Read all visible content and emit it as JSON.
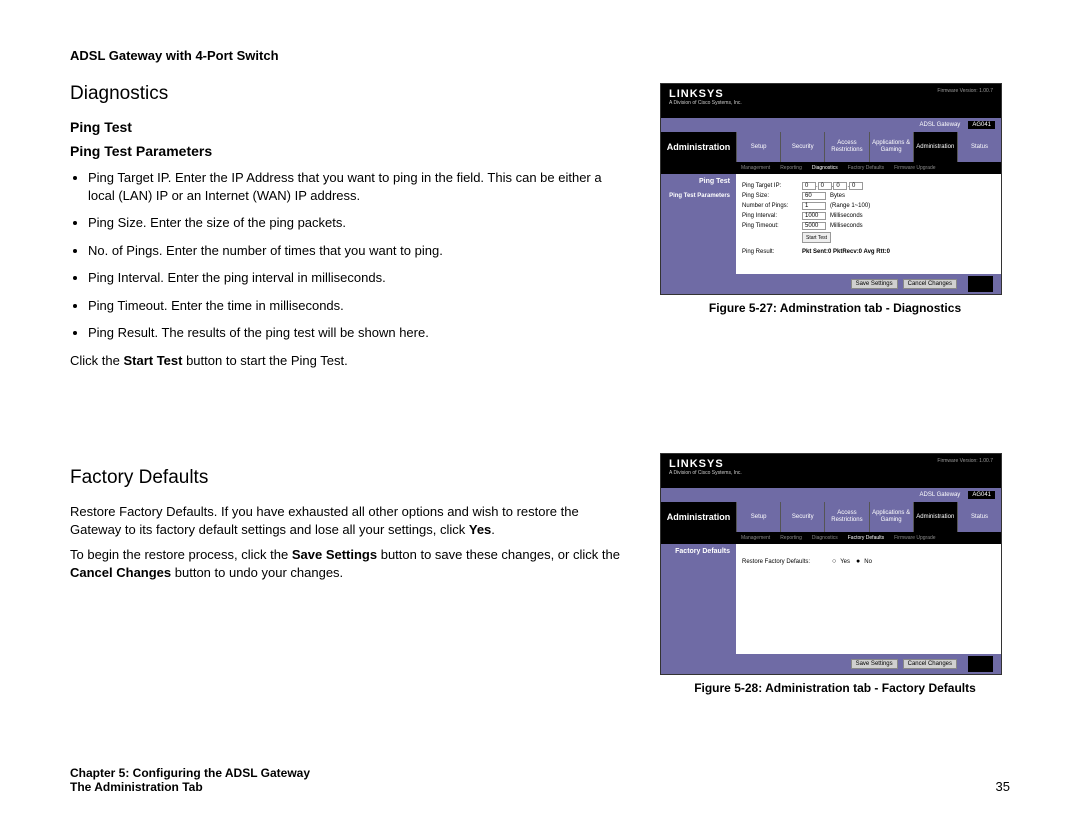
{
  "header": {
    "product": "ADSL Gateway with 4-Port Switch"
  },
  "diagnostics": {
    "title": "Diagnostics",
    "pingTest": "Ping Test",
    "pingParams": "Ping Test Parameters",
    "bullets": {
      "b1a": "Ping Target IP. Enter the IP Address that you want to ping in the field. This can be either a local (LAN) IP or an Internet (WAN) IP address.",
      "b2": "Ping Size. Enter the size of the ping packets.",
      "b3": "No. of Pings. Enter the number of times that you want to ping.",
      "b4": "Ping Interval. Enter the ping interval in milliseconds.",
      "b5": "Ping Timeout. Enter the time in milliseconds.",
      "b6": "Ping Result. The results of the ping test will be shown here."
    },
    "click1": "Click the ",
    "click1b": "Start Test",
    "click1c": " button to start the Ping Test."
  },
  "factory": {
    "title": "Factory Defaults",
    "p1a": "Restore Factory Defaults. If you have exhausted all other options and wish to restore the Gateway to its factory default settings and lose all your settings, click ",
    "p1b": "Yes",
    "p1c": ".",
    "p2a": "To begin the restore process, click the ",
    "p2b": "Save Settings",
    "p2c": " button to save these changes, or click the ",
    "p2d": "Cancel Changes",
    "p2e": " button to undo your changes."
  },
  "fig1": {
    "caption": "Figure 5-27: Adminstration tab - Diagnostics",
    "logo": "LINKSYS",
    "sublogo": "A Division of Cisco Systems, Inc.",
    "fw": "Firmware Version: 1.00.7",
    "gateway": "ADSL Gateway",
    "model": "AG041",
    "navlabel": "Administration",
    "tabs": {
      "t1": "Setup",
      "t2": "Security",
      "t3": "Access Restrictions",
      "t4": "Applications & Gaming",
      "t5": "Administration",
      "t6": "Status"
    },
    "subs": {
      "s1": "Management",
      "s2": "Reporting",
      "s3": "Diagnostics",
      "s4": "Factory Defaults",
      "s5": "Firmware Upgrade"
    },
    "side1": "Ping Test",
    "side2": "Ping Test Parameters",
    "rows": {
      "r1l": "Ping Target IP:",
      "r1v": "0",
      "r1v2": "0",
      "r1v3": "0",
      "r1v4": "0",
      "r2l": "Ping Size:",
      "r2v": "60",
      "r2u": "Bytes",
      "r3l": "Number of Pings:",
      "r3v": "1",
      "r3u": "(Range 1~100)",
      "r4l": "Ping Interval:",
      "r4v": "1000",
      "r4u": "Milliseconds",
      "r5l": "Ping Timeout:",
      "r5v": "5000",
      "r5u": "Milliseconds",
      "r6b": "Start Test",
      "r7l": "Ping Result:",
      "r7v": "Pkt Sent:0 PktRecv:0 Avg Rtt:0"
    },
    "footbtns": {
      "b1": "Save Settings",
      "b2": "Cancel Changes"
    }
  },
  "fig2": {
    "caption": "Figure 5-28: Administration tab - Factory Defaults",
    "side1": "Factory Defaults",
    "row": {
      "label": "Restore Factory Defaults:",
      "opt1": "Yes",
      "opt2": "No"
    }
  },
  "footer": {
    "chapter": "Chapter 5: Configuring the ADSL Gateway",
    "section": "The Administration Tab",
    "page": "35"
  }
}
